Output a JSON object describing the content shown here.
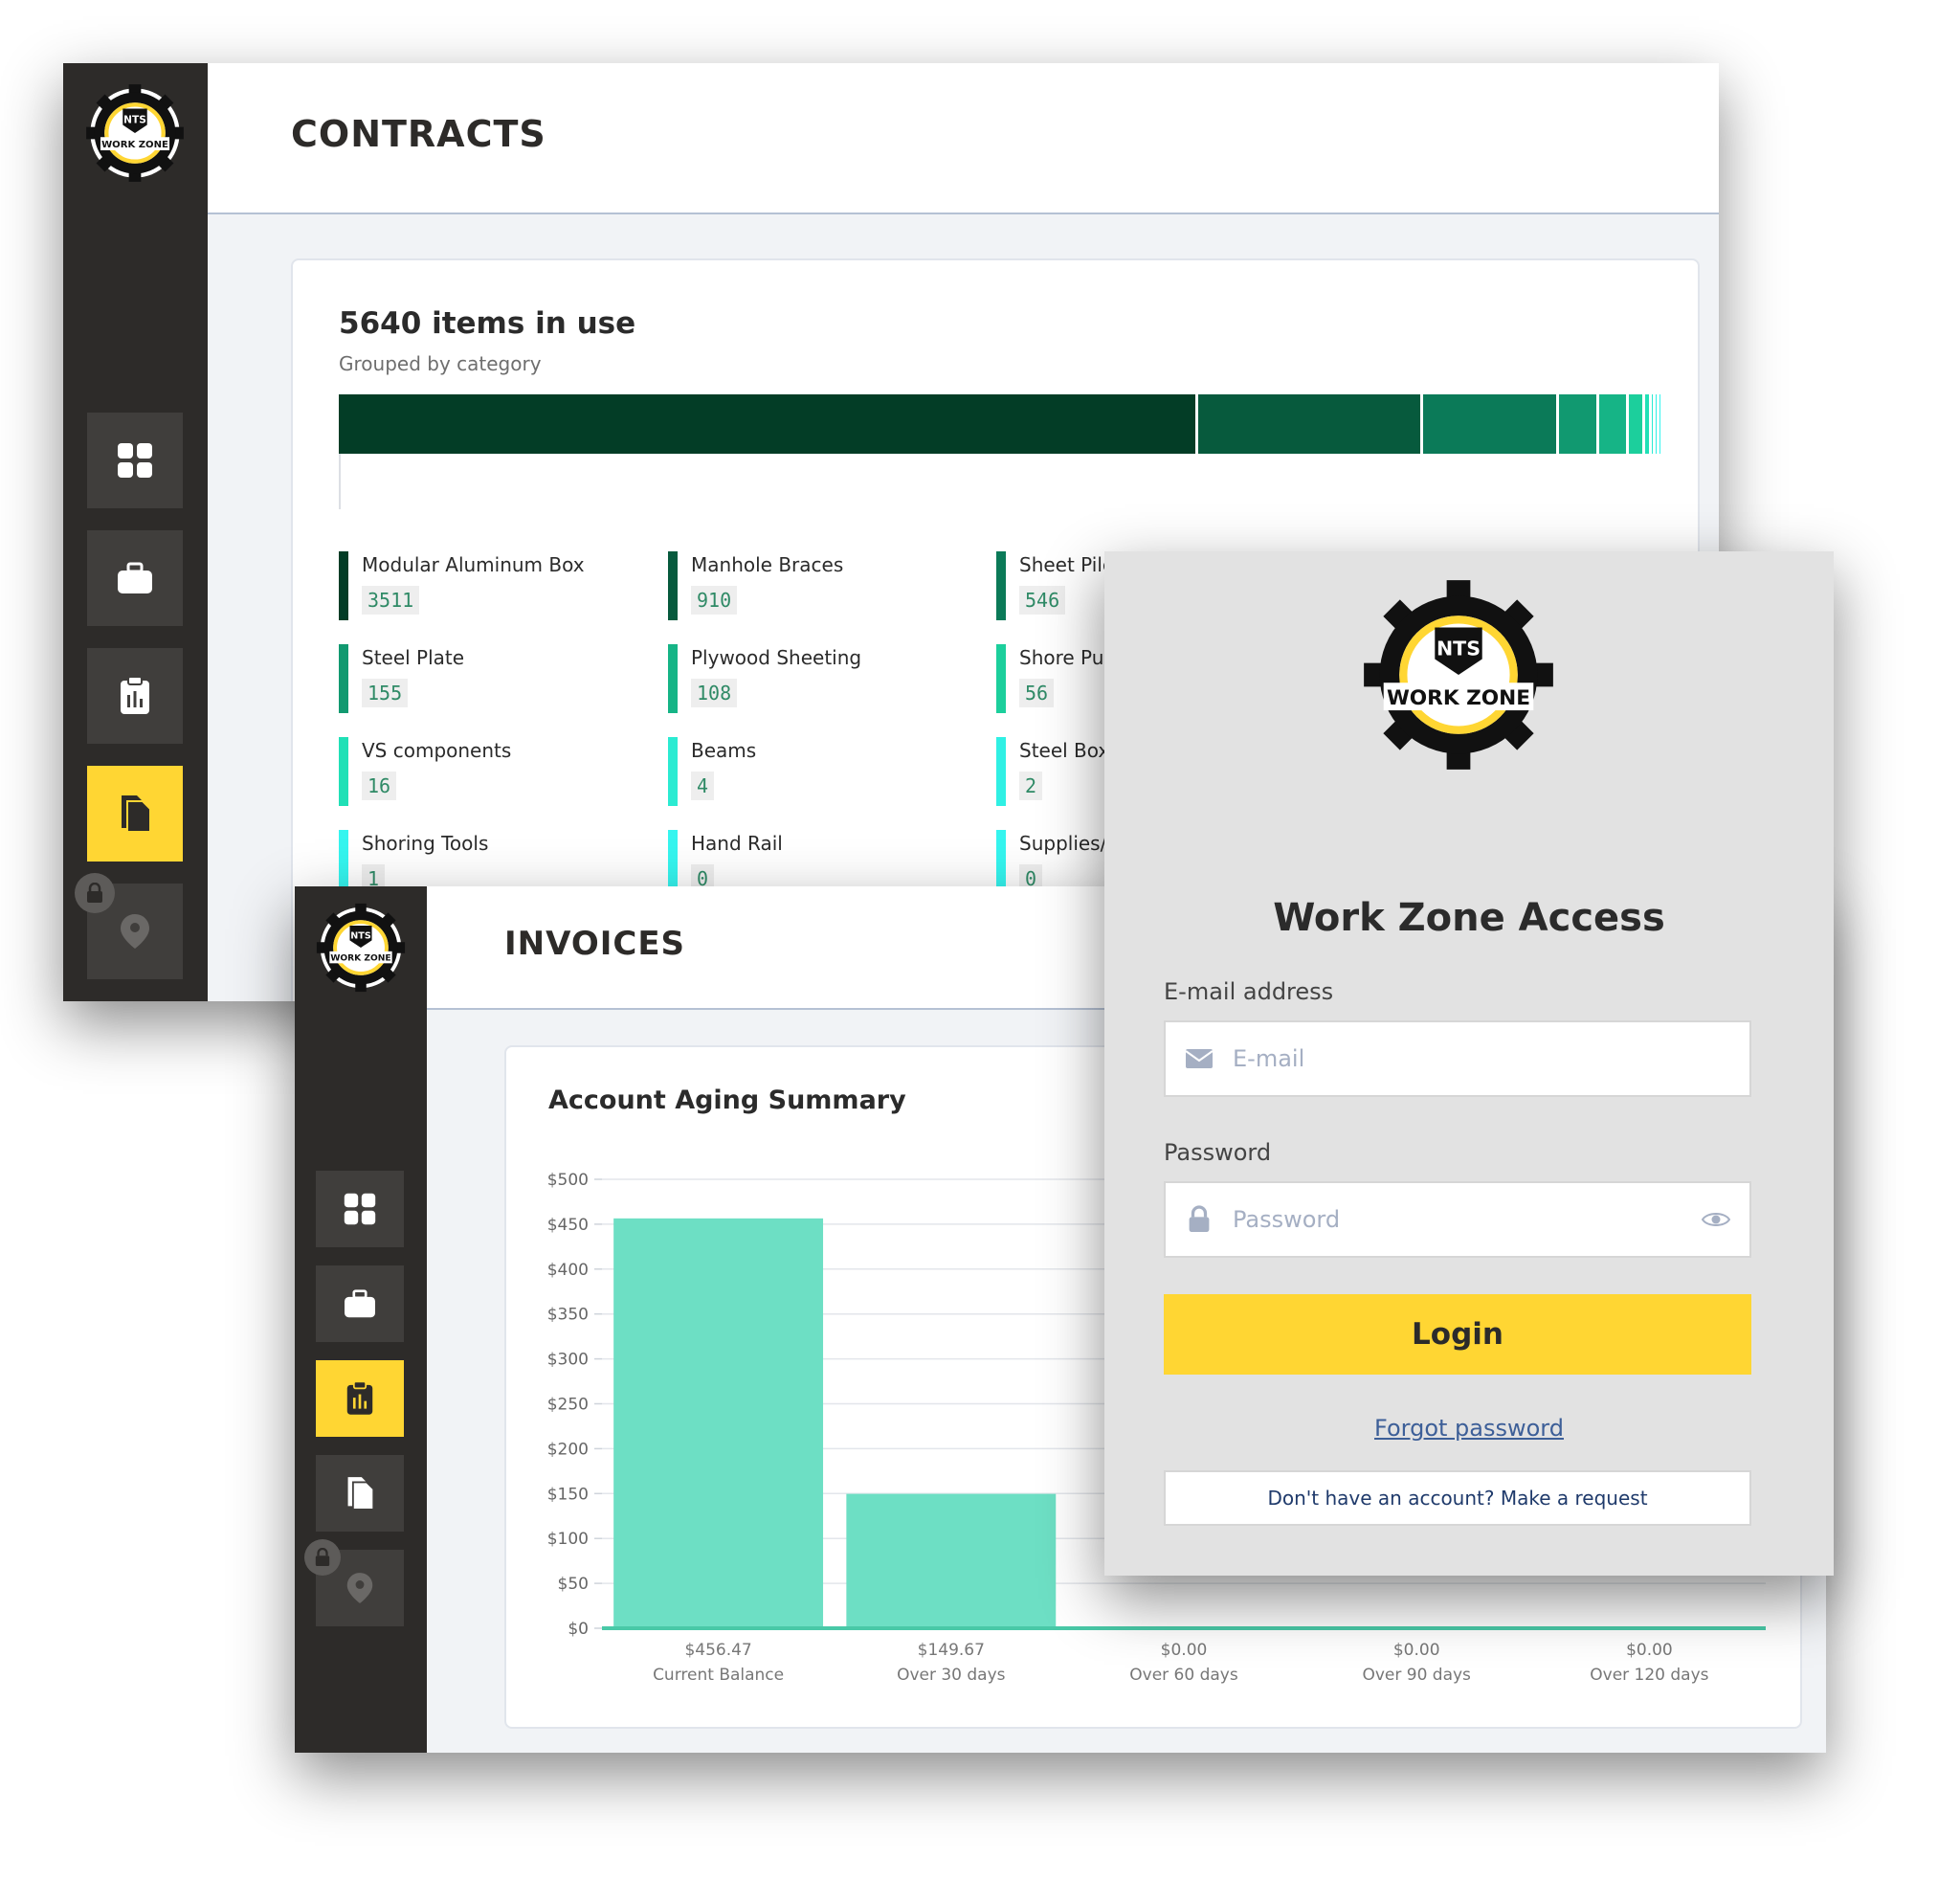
{
  "contracts": {
    "page_title": "CONTRACTS",
    "summary_title": "5640 items in use",
    "summary_subtitle": "Grouped by category",
    "usage_segments": [
      {
        "category": "Modular Aluminum Box",
        "count": 3511,
        "color": "#033d26"
      },
      {
        "category": "Manhole Braces",
        "count": 910,
        "color": "#075a3d"
      },
      {
        "category": "Sheet Piles",
        "count": 546,
        "color": "#0b7a58"
      },
      {
        "category": "Steel Plate",
        "count": 155,
        "color": "#119970"
      },
      {
        "category": "Plywood Sheeting",
        "count": 108,
        "color": "#16b486"
      },
      {
        "category": "Shore Pumps",
        "count": 56,
        "color": "#1ccf9c"
      },
      {
        "category": "VS components",
        "count": 16,
        "color": "#20e0b6"
      },
      {
        "category": "Beams",
        "count": 4,
        "color": "#2bebd2"
      },
      {
        "category": "Steel Box",
        "count": 2,
        "color": "#30f0e4"
      },
      {
        "category": "Shoring Tools",
        "count": 1,
        "color": "#35f5ef"
      }
    ],
    "legend": [
      {
        "label": "Modular Aluminum Box",
        "value": "3511",
        "color": "#033d26"
      },
      {
        "label": "Manhole Braces",
        "value": "910",
        "color": "#075a3d"
      },
      {
        "label": "Sheet Pile",
        "value": "546",
        "color": "#0b7a58"
      },
      {
        "label": "Steel Plate",
        "value": "155",
        "color": "#119970"
      },
      {
        "label": "Plywood Sheeting",
        "value": "108",
        "color": "#16b486"
      },
      {
        "label": "Shore Pu",
        "value": "56",
        "color": "#1ccf9c"
      },
      {
        "label": "VS components",
        "value": "16",
        "color": "#20e0b6"
      },
      {
        "label": "Beams",
        "value": "4",
        "color": "#2bebd2"
      },
      {
        "label": "Steel Box",
        "value": "2",
        "color": "#30f0e4"
      },
      {
        "label": "Shoring Tools",
        "value": "1",
        "color": "#35f5ef"
      },
      {
        "label": "Hand Rail",
        "value": "0",
        "color": "#35f5ef"
      },
      {
        "label": "Supplies/",
        "value": "0",
        "color": "#35f5ef"
      }
    ]
  },
  "invoices": {
    "page_title": "INVOICES"
  },
  "sidebar": {
    "brand_top": "NTS",
    "brand_bottom": "WORK ZONE",
    "nav_items": [
      {
        "icon": "dashboard-grid-icon"
      },
      {
        "icon": "briefcase-icon"
      },
      {
        "icon": "clipboard-chart-icon"
      },
      {
        "icon": "document-icon"
      },
      {
        "icon": "map-pin-icon",
        "locked": true
      }
    ],
    "accent": "#ffd633"
  },
  "chart_data": {
    "type": "bar",
    "title": "Account Aging Summary",
    "categories": [
      "Current Balance",
      "Over 30 days",
      "Over 60 days",
      "Over 90 days",
      "Over 120 days"
    ],
    "values": [
      456.47,
      149.67,
      0,
      0,
      0
    ],
    "value_labels": [
      "$456.47",
      "$149.67",
      "$0.00",
      "$0.00",
      "$0.00"
    ],
    "ylim": [
      0,
      500
    ],
    "yticks": [
      0,
      50,
      100,
      150,
      200,
      250,
      300,
      350,
      400,
      450,
      500
    ],
    "ytick_labels": [
      "$0",
      "$50",
      "$100",
      "$150",
      "$200",
      "$250",
      "$300",
      "$350",
      "$400",
      "$450",
      "$500"
    ],
    "grid": true,
    "bar_color": "#6ddfc4",
    "baseline_color": "#49c9a7"
  },
  "login": {
    "brand_top": "NTS",
    "brand_bottom": "WORK ZONE",
    "heading": "Work Zone Access",
    "email_label": "E-mail address",
    "email_placeholder": "E-mail",
    "password_label": "Password",
    "password_placeholder": "Password",
    "login_label": "Login",
    "forgot_label": "Forgot password",
    "request_label": "Don't have an account? Make a request"
  }
}
